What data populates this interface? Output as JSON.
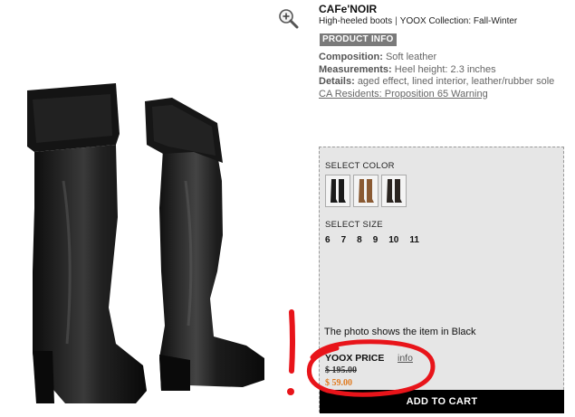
{
  "product": {
    "brand": "CAFe'NOIR",
    "category": "High-heeled boots",
    "collection": "YOOX Collection: Fall-Winter",
    "product_info_label": "PRODUCT INFO",
    "composition_label": "Composition:",
    "composition_value": "Soft leather",
    "measurements_label": "Measurements:",
    "measurements_value": "Heel height: 2.3 inches",
    "details_label": "Details:",
    "details_value": "aged effect, lined interior, leather/rubber sole",
    "prop65_link": "CA Residents: Proposition 65 Warning"
  },
  "selection": {
    "color_label": "SELECT COLOR",
    "colors": [
      {
        "name": "Black",
        "hex": "#1a1a1a"
      },
      {
        "name": "Brown",
        "hex": "#8a5a33"
      },
      {
        "name": "Dark",
        "hex": "#2a2420"
      }
    ],
    "size_label": "SELECT SIZE",
    "sizes": [
      "6",
      "7",
      "8",
      "9",
      "10",
      "11"
    ],
    "photo_note": "The photo shows the item in Black"
  },
  "pricing": {
    "label": "YOOX PRICE",
    "info_link": "info",
    "old_price": "$ 195.00",
    "new_price": "$ 59.00",
    "new_price_color": "#e07a1f"
  },
  "actions": {
    "add_to_cart": "ADD TO CART"
  },
  "icons": {
    "zoom": "zoom-in-icon"
  },
  "colors": {
    "annotation": "#e8141a",
    "badge_bg": "#7a7a7a",
    "panel_bg": "#e6e6e6"
  }
}
